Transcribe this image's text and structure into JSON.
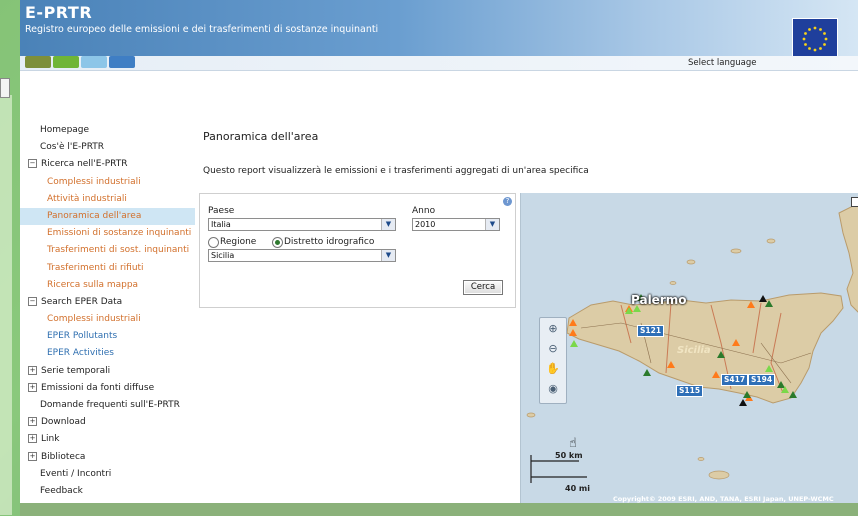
{
  "header": {
    "logo": "E-PRTR",
    "subtitle": "Registro europeo delle emissioni e dei trasferimenti di sostanze inquinanti",
    "select_language": "Select language",
    "stripe_colors": [
      "#7d8f3a",
      "#6fb536",
      "#8dc6e8",
      "#3f7ec4"
    ]
  },
  "nav": {
    "items": [
      {
        "label": "Homepage",
        "type": "top"
      },
      {
        "label": "Cos'è l'E-PRTR",
        "type": "top"
      },
      {
        "label": "Ricerca nell'E-PRTR",
        "type": "expander",
        "state": "−"
      },
      {
        "label": "Complessi industriali",
        "type": "sub"
      },
      {
        "label": "Attività industriali",
        "type": "sub"
      },
      {
        "label": "Panoramica dell'area",
        "type": "sub",
        "active": true
      },
      {
        "label": "Emissioni di sostanze inquinanti",
        "type": "sub"
      },
      {
        "label": "Trasferimenti di sost. inquinanti",
        "type": "sub"
      },
      {
        "label": "Trasferimenti di rifiuti",
        "type": "sub"
      },
      {
        "label": "Ricerca sulla mappa",
        "type": "sub"
      },
      {
        "label": "Search EPER Data",
        "type": "expander",
        "state": "−"
      },
      {
        "label": "Complessi industriali",
        "type": "sub"
      },
      {
        "label": "EPER Pollutants",
        "type": "sub-blue"
      },
      {
        "label": "EPER Activities",
        "type": "sub-blue"
      },
      {
        "label": "Serie temporali",
        "type": "expander",
        "state": "+"
      },
      {
        "label": "Emissioni da fonti diffuse",
        "type": "expander",
        "state": "+"
      },
      {
        "label": "Domande frequenti sull'E-PRTR",
        "type": "top"
      },
      {
        "label": "Download",
        "type": "expander",
        "state": "+"
      },
      {
        "label": "Link",
        "type": "expander",
        "state": "+"
      },
      {
        "label": "Biblioteca",
        "type": "expander",
        "state": "+"
      },
      {
        "label": "Eventi / Incontri",
        "type": "top"
      },
      {
        "label": "Feedback",
        "type": "top"
      }
    ]
  },
  "main": {
    "title": "Panoramica dell'area",
    "description": "Questo report visualizzerà le emissioni e i trasferimenti aggregati di un'area specifica"
  },
  "form": {
    "country_label": "Paese",
    "country_value": "Italia",
    "year_label": "Anno",
    "year_value": "2010",
    "radio_region": "Regione",
    "radio_district": "Distretto idrografico",
    "selected_radio": "Distretto idrografico",
    "area_value": "Sicilia",
    "search_button": "Cerca"
  },
  "map": {
    "city_label": "Palermo",
    "region_label": "Sicilia",
    "routes": [
      "S121",
      "S115",
      "S417",
      "S194"
    ],
    "scale_km": "50 km",
    "scale_mi": "40 mi",
    "copyright": "Copyright© 2009 ESRI, AND, TANA, ESRI Japan, UNEP-WCMC",
    "sea_color": "#c8d9e6",
    "land_color": "#d8c9a3"
  }
}
